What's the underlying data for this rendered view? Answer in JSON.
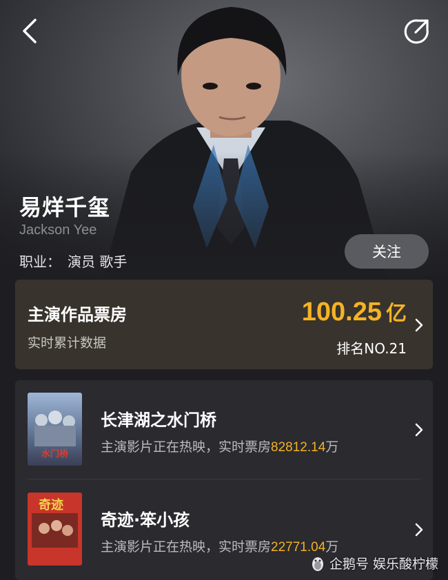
{
  "profile": {
    "name_cn": "易烊千玺",
    "name_en": "Jackson Yee",
    "profession_label": "职业：",
    "profession_value": "演员 歌手",
    "follow_label": "关注"
  },
  "boxoffice": {
    "title": "主演作品票房",
    "subtitle": "实时累计数据",
    "amount": "100.25",
    "unit": "亿",
    "rank": "排名NO.21"
  },
  "films": [
    {
      "title": "长津湖之水门桥",
      "desc_prefix": "主演影片正在热映，实时票房",
      "gross": "82812.14",
      "gross_unit": "万",
      "poster_text": "水门桥"
    },
    {
      "title": "奇迹·笨小孩",
      "desc_prefix": "主演影片正在热映，实时票房",
      "gross": "22771.04",
      "gross_unit": "万",
      "poster_text": "奇迹"
    }
  ],
  "watermark": "企鹅号 娱乐酸柠檬",
  "colors": {
    "accent": "#f5b324",
    "background": "#1e1e22"
  },
  "icons": [
    "back-arrow-icon",
    "share-icon",
    "chevron-right-icon",
    "penguin-icon"
  ]
}
